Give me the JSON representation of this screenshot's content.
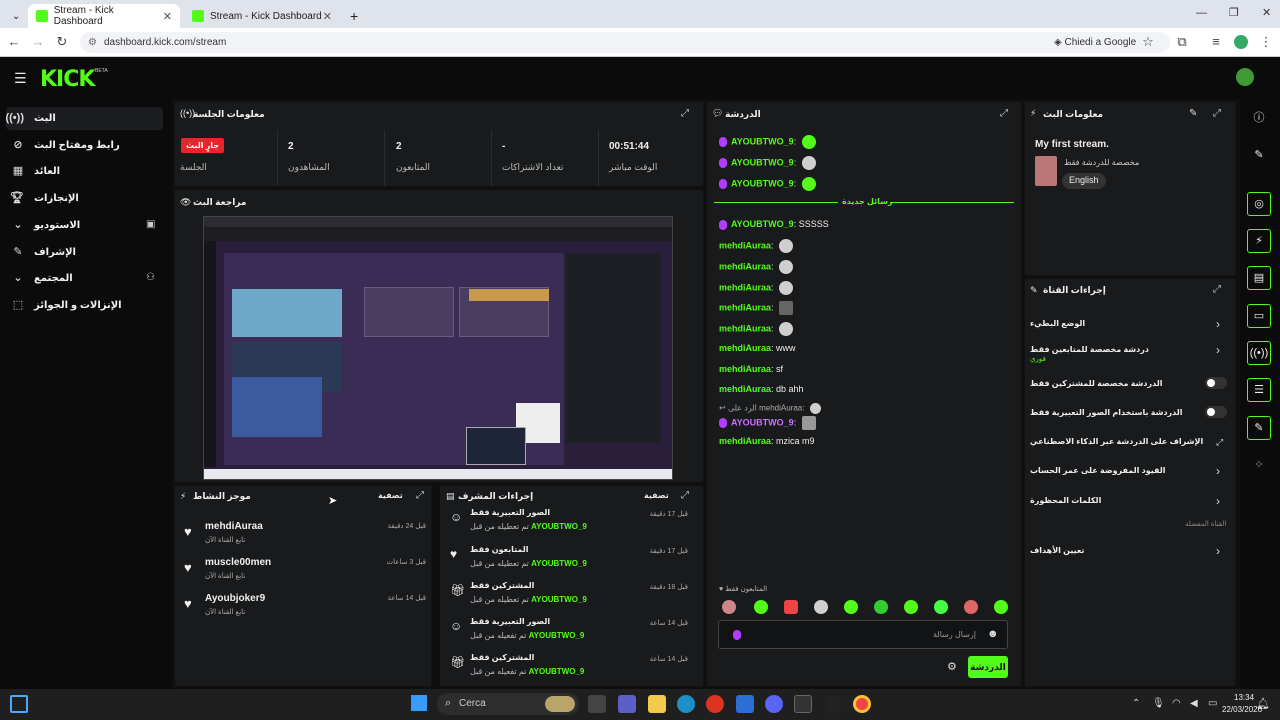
{
  "browser": {
    "tabs": [
      {
        "title": "Stream - Kick Dashboard",
        "active": true
      },
      {
        "title": "Stream - Kick Dashboard",
        "active": false
      }
    ],
    "url": "dashboard.kick.com/stream",
    "google_pill": "Chiedi a Google"
  },
  "brand": {
    "logo": "KICK",
    "beta": "BETA",
    "accent": "#53fc18"
  },
  "sidebar": {
    "items": [
      {
        "label": "البث",
        "icon": "broadcast-icon",
        "selected": true
      },
      {
        "label": "رابط ومفتاح البث",
        "icon": "link-icon"
      },
      {
        "label": "العائد",
        "icon": "chart-icon"
      },
      {
        "label": "الإنجازات",
        "icon": "trophy-icon"
      },
      {
        "label": "الاستوديو",
        "icon": "chevron-down-icon"
      },
      {
        "label": "الإشراف",
        "icon": "wrench-icon"
      },
      {
        "label": "المجتمع",
        "icon": "chevron-down-icon"
      },
      {
        "label": "الإنزالات و الجوائز",
        "icon": "drops-icon"
      }
    ]
  },
  "session": {
    "title": "معلومات الجلسة",
    "live_badge": "جارٍ البث",
    "stats": [
      {
        "value": "",
        "label": "الجلسة"
      },
      {
        "value": "2",
        "label": "المشاهدون"
      },
      {
        "value": "2",
        "label": "المتابعون"
      },
      {
        "value": "-",
        "label": "تعداد الاشتراكات"
      },
      {
        "value": "00:51:44",
        "label": "الوقت مباشر"
      }
    ]
  },
  "preview": {
    "title": "مراجعة البث"
  },
  "activity": {
    "title": "موجز النشاط",
    "filter": "تصفية",
    "items": [
      {
        "name": "mehdiAuraa",
        "sub": "تابع القناة الآن",
        "time": "قبل 24 دقيقة"
      },
      {
        "name": "muscle00men",
        "sub": "تابع القناة الآن",
        "time": "قبل 3 ساعات"
      },
      {
        "name": "Ayoubjoker9",
        "sub": "تابع القناة الآن",
        "time": "قبل 14 ساعة"
      }
    ]
  },
  "modactions": {
    "title": "إجراءات المشرف",
    "filter": "تصفية",
    "items": [
      {
        "title": "الصور التعبيرية فقط",
        "by": "تم تعطيله من قبل",
        "user": "AYOUBTWO_9",
        "time": "قبل 17 دقيقة",
        "icon": "emoji-icon"
      },
      {
        "title": "المتابعون فقط",
        "by": "تم تعطيله من قبل",
        "user": "AYOUBTWO_9",
        "time": "قبل 17 دقيقة",
        "icon": "heart-icon"
      },
      {
        "title": "المشتركين فقط",
        "by": "تم تعطيله من قبل",
        "user": "AYOUBTWO_9",
        "time": "قبل 18 دقيقة",
        "icon": "gift-icon"
      },
      {
        "title": "الصور التعبيرية فقط",
        "by": "تم تفعيله من قبل",
        "user": "AYOUBTWO_9",
        "time": "قبل 14 ساعة",
        "icon": "emoji-icon"
      },
      {
        "title": "المشتركين فقط",
        "by": "تم تفعيله من قبل",
        "user": "AYOUBTWO_9",
        "time": "قبل 14 ساعة",
        "icon": "gift-icon"
      }
    ]
  },
  "chat": {
    "title": "الدردشة",
    "new_messages": "رسائل جديدة",
    "messages_before": [
      {
        "user": "AYOUBTWO_9",
        "text": "",
        "emote": true
      },
      {
        "user": "AYOUBTWO_9",
        "text": "",
        "emote": true
      },
      {
        "user": "AYOUBTWO_9",
        "text": "",
        "emote": true
      }
    ],
    "messages_after": [
      {
        "user": "AYOUBTWO_9",
        "text": "SSSSS",
        "badge": true
      },
      {
        "user": "mehdiAuraa",
        "text": "",
        "emote": true
      },
      {
        "user": "mehdiAuraa",
        "text": "",
        "emote": true
      },
      {
        "user": "mehdiAuraa",
        "text": "",
        "emote": true
      },
      {
        "user": "mehdiAuraa",
        "text": "",
        "emote": true
      },
      {
        "user": "mehdiAuraa",
        "text": "",
        "emote": true
      },
      {
        "user": "mehdiAuraa",
        "text": "www"
      },
      {
        "user": "mehdiAuraa",
        "text": "sf"
      },
      {
        "user": "mehdiAuraa",
        "text": "db ahh"
      }
    ],
    "reply_to": "الرد على mehdiAuraa:",
    "reply_user": "AYOUBTWO_9",
    "last_msg": {
      "user": "mehdiAuraa",
      "text": "mzica m9"
    },
    "followers_only_label": "المتابعون فقط",
    "input_placeholder": "إرسال رسالة",
    "send_button": "الدردشة"
  },
  "streaminfo": {
    "title": "معلومات البث",
    "stream_title": "My first stream.",
    "category": "مخصصة للدردشة فقط",
    "language": "English"
  },
  "channelactions": {
    "title": "إجراءات القناة",
    "items": [
      {
        "label": "الوضع البطيء",
        "control": "chevron"
      },
      {
        "label": "دردشة مخصصة للمتابعين فقط",
        "sub": "فوري",
        "control": "chevron"
      },
      {
        "label": "الدردشة مخصصة للمشتركين فقط",
        "control": "toggle"
      },
      {
        "label": "الدردشة باستخدام الصور التعبيرية فقط",
        "control": "toggle"
      },
      {
        "label": "الإشراف على الدردشة عبر الذكاء الاصطناعي",
        "control": "external"
      },
      {
        "label": "القيود المفروضة على عمر الحساب",
        "control": "chevron"
      },
      {
        "label": "الكلمات المحظورة",
        "control": "chevron"
      }
    ],
    "section_label": "القناة المفضلة",
    "goals": "تعيين الأهداف"
  },
  "taskbar": {
    "search": "Cerca",
    "time": "13:34",
    "date": "22/03/2026"
  }
}
